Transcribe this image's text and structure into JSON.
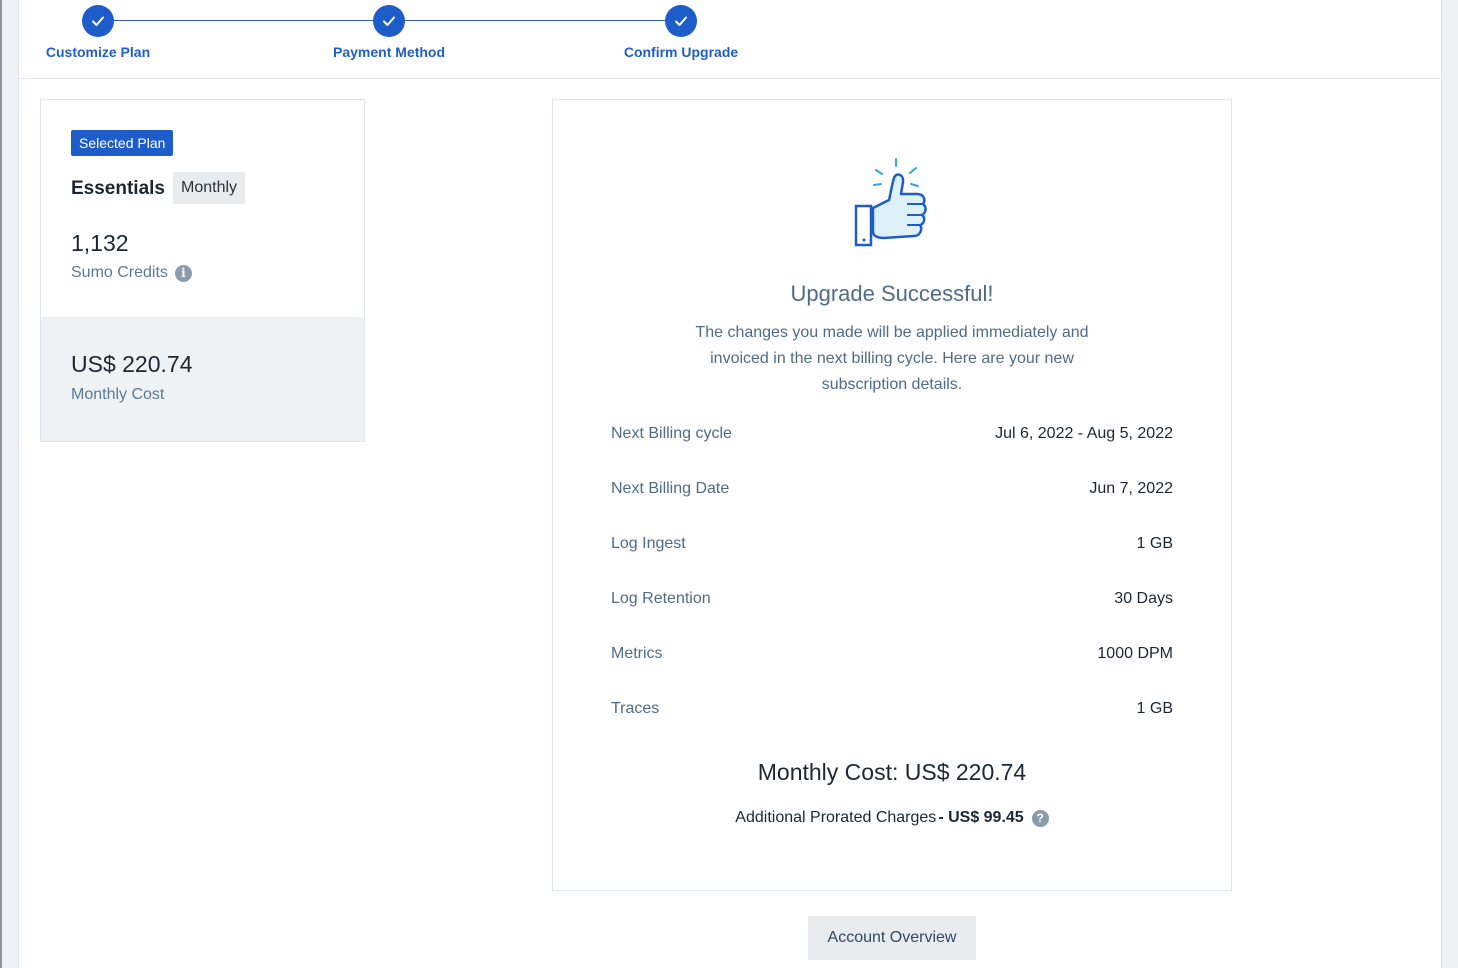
{
  "stepper": {
    "steps": [
      {
        "label": "Customize Plan",
        "state": "complete"
      },
      {
        "label": "Payment Method",
        "state": "complete"
      },
      {
        "label": "Confirm Upgrade",
        "state": "complete"
      }
    ]
  },
  "plan": {
    "badge": "Selected Plan",
    "name": "Essentials",
    "period": "Monthly",
    "credits_value": "1,132",
    "credits_label": "Sumo Credits",
    "cost_value": "US$ 220.74",
    "cost_label": "Monthly Cost"
  },
  "success": {
    "title": "Upgrade Successful!",
    "message": "The changes you made will be applied immediately and invoiced in the next billing cycle. Here are your new subscription details.",
    "details": [
      {
        "label": "Next Billing cycle",
        "value": "Jul 6, 2022 - Aug 5, 2022"
      },
      {
        "label": "Next Billing Date",
        "value": "Jun 7, 2022"
      },
      {
        "label": "Log Ingest",
        "value": "1 GB"
      },
      {
        "label": "Log Retention",
        "value": "30 Days"
      },
      {
        "label": "Metrics",
        "value": "1000 DPM"
      },
      {
        "label": "Traces",
        "value": "1 GB"
      }
    ],
    "monthly_total": "Monthly Cost: US$ 220.74",
    "prorated_label": "Additional Prorated Charges",
    "prorated_value": "- US$ 99.45"
  },
  "actions": {
    "account_overview": "Account Overview"
  },
  "icons": {
    "step_complete": "checkmark-icon",
    "credits_info": "info-icon",
    "prorated_help": "question-icon",
    "success": "thumbs-up-icon"
  },
  "colors": {
    "accent": "#1e5dc9",
    "muted_text": "#4e6b89",
    "panel_bg": "#eef2f5"
  }
}
